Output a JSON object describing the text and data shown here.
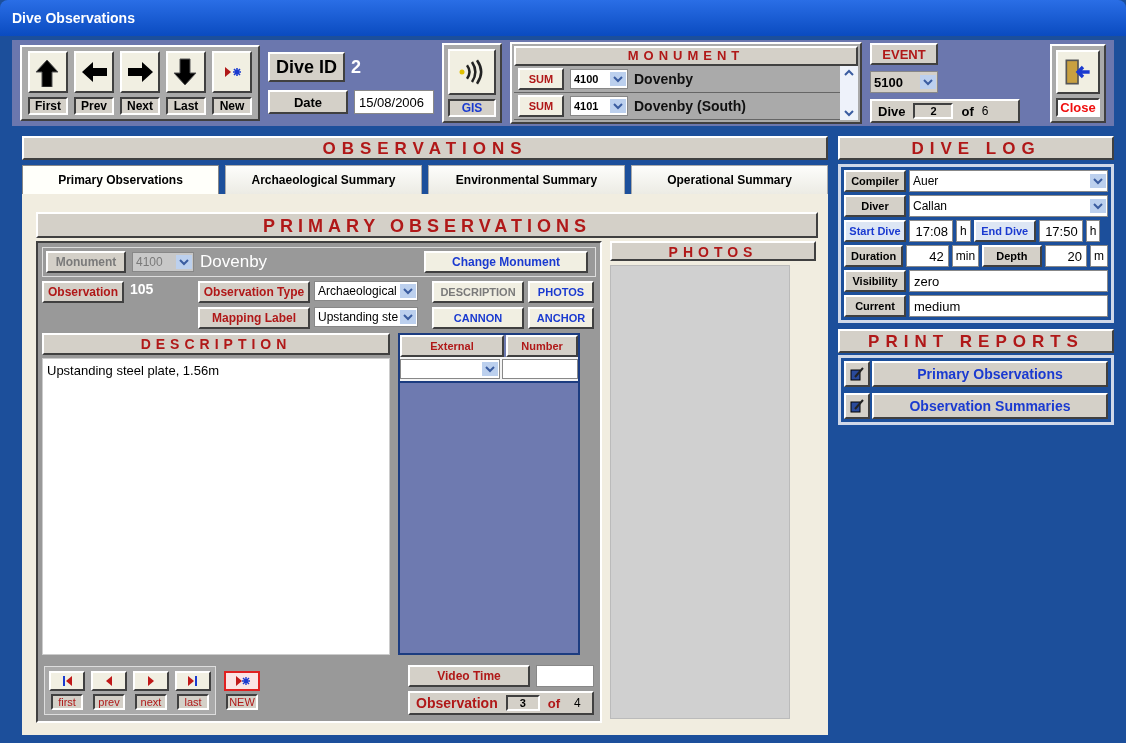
{
  "window": {
    "title": "Dive Observations"
  },
  "nav_buttons": [
    {
      "kind": "first",
      "label": "First"
    },
    {
      "kind": "prev",
      "label": "Prev"
    },
    {
      "kind": "next",
      "label": "Next"
    },
    {
      "kind": "last",
      "label": "Last"
    },
    {
      "kind": "new",
      "label": "New"
    }
  ],
  "dive_id": {
    "label": "Dive ID",
    "value": "2"
  },
  "date": {
    "label": "Date",
    "value": "15/08/2006"
  },
  "gis": {
    "label": "GIS"
  },
  "monument": {
    "title": "MONUMENT",
    "rows": [
      {
        "sum": "SUM",
        "code": "4100",
        "name": "Dovenby"
      },
      {
        "sum": "SUM",
        "code": "4101",
        "name": "Dovenby (South)"
      }
    ]
  },
  "event": {
    "title": "EVENT",
    "value": "5100"
  },
  "dive_counter": {
    "label": "Dive",
    "current": "2",
    "of": "of",
    "total": "6"
  },
  "close": {
    "label": "Close"
  },
  "observations": {
    "title": "OBSERVATIONS",
    "tabs": [
      {
        "label": "Primary Observations",
        "selected": true
      },
      {
        "label": "Archaeological Summary",
        "selected": false
      },
      {
        "label": "Environmental Summary",
        "selected": false
      },
      {
        "label": "Operational Summary",
        "selected": false
      }
    ]
  },
  "primary": {
    "title": "PRIMARY OBSERVATIONS",
    "monument_button": {
      "label": "Monument",
      "disabled": true
    },
    "monument_code": {
      "value": "4100",
      "disabled": true
    },
    "monument_name": "Dovenby",
    "change_monument": "Change Monument",
    "observation": {
      "label": "Observation",
      "value": "105"
    },
    "observation_type": {
      "label": "Observation Type",
      "value": "Archaeological"
    },
    "mapping_label": {
      "label": "Mapping Label",
      "value": "Upstanding ste"
    },
    "actions": [
      {
        "label": "DESCRIPTION",
        "disabled": true
      },
      {
        "label": "PHOTOS",
        "disabled": false
      },
      {
        "label": "CANNON",
        "disabled": false
      },
      {
        "label": "ANCHOR",
        "disabled": false
      }
    ],
    "description": {
      "title": "DESCRIPTION",
      "text": "Upstanding steel plate, 1.56m"
    },
    "external_table": {
      "columns": [
        "External",
        "Number"
      ]
    },
    "record_nav": [
      {
        "kind": "first",
        "label": "first",
        "focused": false
      },
      {
        "kind": "prev",
        "label": "prev",
        "focused": false
      },
      {
        "kind": "next",
        "label": "next",
        "focused": false
      },
      {
        "kind": "last",
        "label": "last",
        "focused": false
      },
      {
        "kind": "new",
        "label": "NEW",
        "focused": true
      }
    ],
    "video_time": {
      "label": "Video Time"
    },
    "observation_counter": {
      "label": "Observation",
      "current": "3",
      "of": "of",
      "total": "4"
    }
  },
  "photos": {
    "title": "PHOTOS"
  },
  "dive_log": {
    "title": "DIVE LOG",
    "rows": [
      {
        "kind": "combo",
        "label": "Compiler",
        "action": false,
        "value": "Auer"
      },
      {
        "kind": "combo",
        "label": "Diver",
        "action": false,
        "value": "Callan"
      },
      {
        "kind": "pair",
        "items": [
          {
            "label": "Start Dive",
            "action": true,
            "value": "17:08",
            "unit": "h"
          },
          {
            "label": "End Dive",
            "action": true,
            "value": "17:50",
            "unit": "h"
          }
        ]
      },
      {
        "kind": "pair",
        "items": [
          {
            "label": "Duration",
            "action": false,
            "value": "42",
            "unit": "min"
          },
          {
            "label": "Depth",
            "action": false,
            "value": "20",
            "unit": "m"
          }
        ]
      },
      {
        "kind": "text",
        "label": "Visibility",
        "action": false,
        "value": "zero"
      },
      {
        "kind": "text",
        "label": "Current",
        "action": false,
        "value": "medium"
      }
    ]
  },
  "print_reports": {
    "title": "PRINT REPORTS",
    "items": [
      "Primary Observations",
      "Observation Summaries"
    ]
  }
}
